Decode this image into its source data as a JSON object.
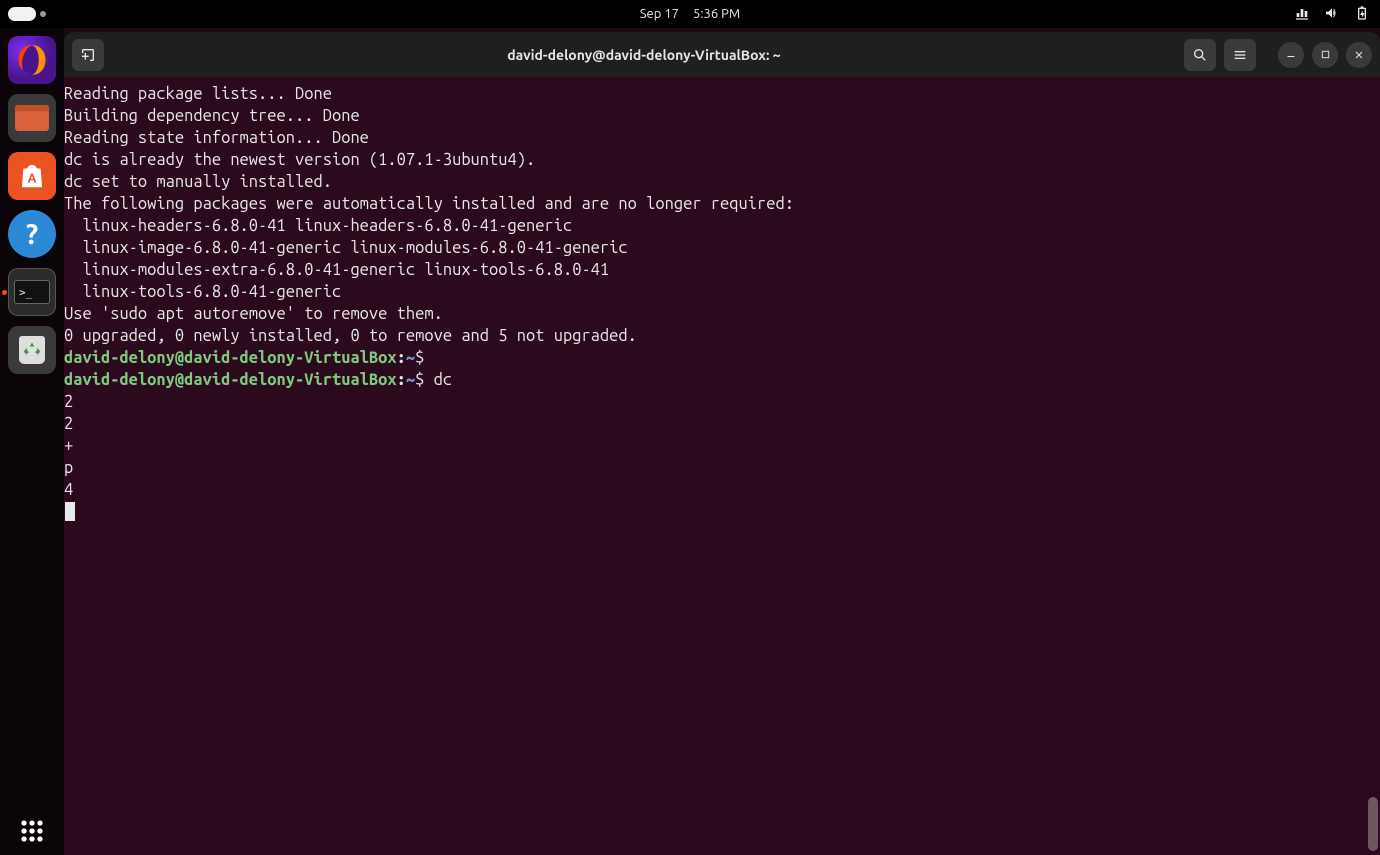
{
  "topbar": {
    "date": "Sep 17",
    "time": "5:36 PM"
  },
  "dock": {
    "firefox": "Firefox",
    "files": "Files",
    "software": "Ubuntu Software",
    "help": "Help",
    "terminal": "Terminal",
    "trash": "Trash",
    "show_apps": "Show Applications"
  },
  "window": {
    "title": "david-delony@david-delony-VirtualBox: ~"
  },
  "prompt": {
    "user_host": "david-delony@david-delony-VirtualBox",
    "sep": ":",
    "path": "~",
    "dollar": "$"
  },
  "commands": {
    "empty": " ",
    "dc": " dc"
  },
  "output": {
    "l1": "Reading package lists... Done",
    "l2": "Building dependency tree... Done",
    "l3": "Reading state information... Done",
    "l4": "dc is already the newest version (1.07.1-3ubuntu4).",
    "l5": "dc set to manually installed.",
    "l6": "The following packages were automatically installed and are no longer required:",
    "l7": "  linux-headers-6.8.0-41 linux-headers-6.8.0-41-generic",
    "l8": "  linux-image-6.8.0-41-generic linux-modules-6.8.0-41-generic",
    "l9": "  linux-modules-extra-6.8.0-41-generic linux-tools-6.8.0-41",
    "l10": "  linux-tools-6.8.0-41-generic",
    "l11": "Use 'sudo apt autoremove' to remove them.",
    "l12": "0 upgraded, 0 newly installed, 0 to remove and 5 not upgraded.",
    "d1": "2",
    "d2": "2",
    "d3": "+",
    "d4": "p",
    "d5": "4"
  }
}
